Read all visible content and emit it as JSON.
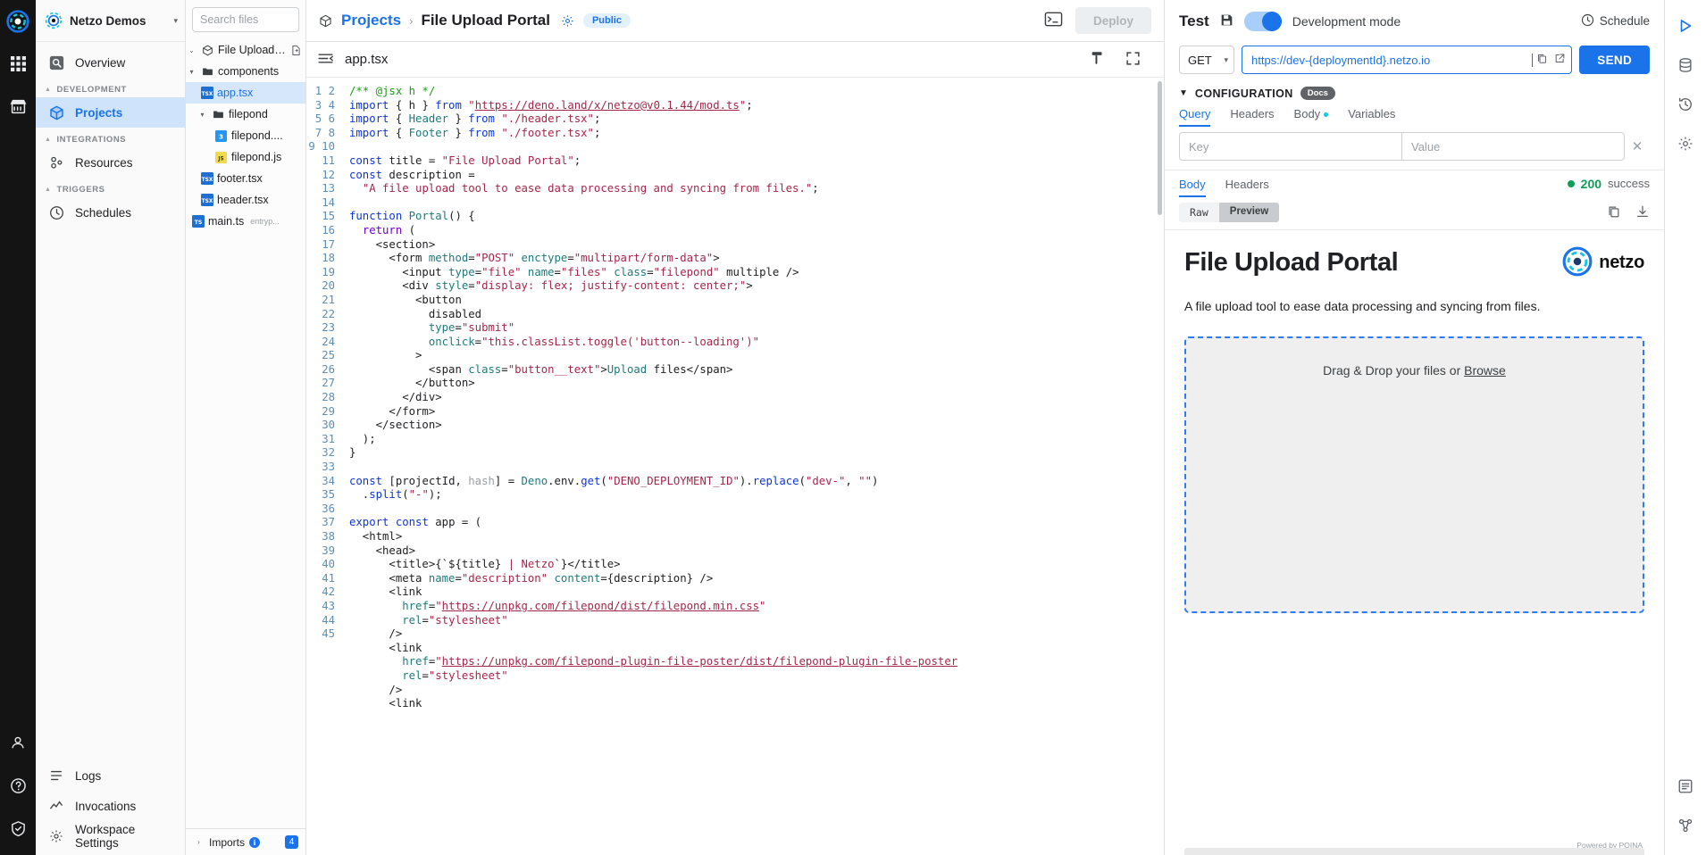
{
  "rail": {
    "logo": "netzo-logo",
    "items": [
      {
        "name": "apps-grid-icon"
      },
      {
        "name": "marketplace-icon"
      }
    ],
    "bottom": [
      {
        "name": "user-avatar-icon"
      },
      {
        "name": "help-icon"
      },
      {
        "name": "shield-icon"
      }
    ]
  },
  "sidebar": {
    "org": {
      "name": "Netzo Demos",
      "caret": "▾"
    },
    "items": [
      {
        "label": "Overview",
        "icon": "overview-icon",
        "active": false
      },
      {
        "label": "Projects",
        "icon": "projects-cube-icon",
        "active": true
      },
      {
        "label": "Resources",
        "icon": "resources-nodes-icon",
        "active": false
      },
      {
        "label": "Schedules",
        "icon": "clock-icon",
        "active": false
      }
    ],
    "groups": [
      {
        "label": "DEVELOPMENT"
      },
      {
        "label": "INTEGRATIONS"
      },
      {
        "label": "TRIGGERS"
      }
    ],
    "bottom_items": [
      {
        "label": "Logs",
        "icon": "logs-icon"
      },
      {
        "label": "Invocations",
        "icon": "invocations-icon"
      },
      {
        "label": "Workspace Settings",
        "icon": "settings-icon"
      }
    ]
  },
  "explorer": {
    "search_placeholder": "Search files",
    "tree": [
      {
        "label": "File Upload ...",
        "icon": "project-cube-icon",
        "arrow": "⌄",
        "indent": 0,
        "selected": false,
        "new_file": true
      },
      {
        "label": "components",
        "icon": "folder-icon",
        "arrow": "▾",
        "indent": 0,
        "selected": false
      },
      {
        "label": "app.tsx",
        "icon": "tsx-file-icon",
        "arrow": "",
        "indent": 1,
        "selected": true
      },
      {
        "label": "filepond",
        "icon": "folder-icon",
        "arrow": "▾",
        "indent": 1,
        "selected": false
      },
      {
        "label": "filepond....",
        "icon": "css-file-icon",
        "arrow": "",
        "indent": 2,
        "selected": false
      },
      {
        "label": "filepond.js",
        "icon": "js-file-icon",
        "arrow": "",
        "indent": 2,
        "selected": false
      },
      {
        "label": "footer.tsx",
        "icon": "tsx-file-icon",
        "arrow": "",
        "indent": 1,
        "selected": false
      },
      {
        "label": "header.tsx",
        "icon": "tsx-file-icon",
        "arrow": "",
        "indent": 1,
        "selected": false
      },
      {
        "label": "main.ts",
        "icon": "ts-file-icon",
        "arrow": "",
        "indent": 0,
        "selected": false,
        "sub": "entryp..."
      }
    ],
    "imports": {
      "label": "Imports",
      "arrow": "›",
      "count": "4"
    }
  },
  "topbar": {
    "breadcrumb_root": "Projects",
    "breadcrumb_sep": "›",
    "breadcrumb_current": "File Upload Portal",
    "visibility": "Public",
    "gear_icon": "gear-icon",
    "terminal_icon": "terminal-icon",
    "deploy_label": "Deploy"
  },
  "editor": {
    "filename": "app.tsx",
    "collapse_icon": "collapse-sidebar-icon",
    "format_icon": "format-icon",
    "fullscreen_icon": "fullscreen-icon",
    "first_line": 1,
    "last_line": 45,
    "lines": [
      "/** @jsx h */",
      "import { h } from \"https://deno.land/x/netzo@v0.1.44/mod.ts\";",
      "import { Header } from \"./header.tsx\";",
      "import { Footer } from \"./footer.tsx\";",
      "",
      "const title = \"File Upload Portal\";",
      "const description =",
      "  \"A file upload tool to ease data processing and syncing from files.\";",
      "",
      "function Portal() {",
      "  return (",
      "    <section>",
      "      <form method=\"POST\" enctype=\"multipart/form-data\">",
      "        <input type=\"file\" name=\"files\" class=\"filepond\" multiple />",
      "        <div style=\"display: flex; justify-content: center;\">",
      "          <button",
      "            disabled",
      "            type=\"submit\"",
      "            onclick=\"this.classList.toggle('button--loading')\"",
      "          >",
      "            <span class=\"button__text\">Upload files</span>",
      "          </button>",
      "        </div>",
      "      </form>",
      "    </section>",
      "  );",
      "}",
      "",
      "const [projectId, hash] = Deno.env.get(\"DENO_DEPLOYMENT_ID\").replace(\"dev-\", \"\")",
      "  .split(\"-\");",
      "",
      "export const app = (",
      "  <html>",
      "    <head>",
      "      <title>{`${title} | Netzo`}</title>",
      "      <meta name=\"description\" content={description} />",
      "      <link",
      "        href=\"https://unpkg.com/filepond/dist/filepond.min.css\"",
      "        rel=\"stylesheet\"",
      "      />",
      "      <link",
      "        href=\"https://unpkg.com/filepond-plugin-file-poster/dist/filepond-plugin-file-poster",
      "        rel=\"stylesheet\"",
      "      />",
      "      <link"
    ]
  },
  "test_panel": {
    "title": "Test",
    "save_icon": "save-icon",
    "toggle_label": "Development mode",
    "toggle_on": true,
    "schedule_label": "Schedule",
    "schedule_icon": "clock-icon",
    "method": "GET",
    "url": "https://dev-{deploymentId}.netzo.io",
    "copy_icon": "copy-icon",
    "open-external_icon": "open-external-icon",
    "send_label": "SEND",
    "config_label": "CONFIGURATION",
    "config_arrow": "▼",
    "docs_label": "Docs",
    "tabs": [
      {
        "label": "Query",
        "active": true,
        "dot": false
      },
      {
        "label": "Headers",
        "active": false,
        "dot": false
      },
      {
        "label": "Body",
        "active": false,
        "dot": true
      },
      {
        "label": "Variables",
        "active": false,
        "dot": false
      }
    ],
    "kv": {
      "key_placeholder": "Key",
      "value_placeholder": "Value",
      "clear_icon": "close-icon"
    },
    "response": {
      "tabs": [
        {
          "label": "Body",
          "active": true
        },
        {
          "label": "Headers",
          "active": false
        }
      ],
      "status_code": "200",
      "status_text": "success",
      "status_color": "#0f9d58",
      "view_modes": [
        {
          "label": "Raw",
          "active": false
        },
        {
          "label": "Preview",
          "active": true
        }
      ],
      "copy_icon": "copy-icon",
      "download_icon": "download-icon"
    },
    "preview": {
      "title": "File Upload Portal",
      "brand": "netzo",
      "description": "A file upload tool to ease data processing and syncing from files.",
      "dropzone_text": "Drag & Drop your files or ",
      "dropzone_link": "Browse",
      "powered_by": "Powered by PQINA"
    }
  },
  "right_rail": {
    "items": [
      {
        "name": "play-icon"
      },
      {
        "name": "database-icon"
      },
      {
        "name": "history-icon"
      },
      {
        "name": "settings-gear-icon"
      }
    ],
    "bottom": [
      {
        "name": "env-icon"
      },
      {
        "name": "graph-icon"
      }
    ]
  },
  "colors": {
    "accent": "#1a73e8",
    "success": "#0f9d58",
    "rail_bg": "#141414",
    "selected_bg": "#d6e7fb",
    "dropzone_border": "#2f7bf6"
  }
}
